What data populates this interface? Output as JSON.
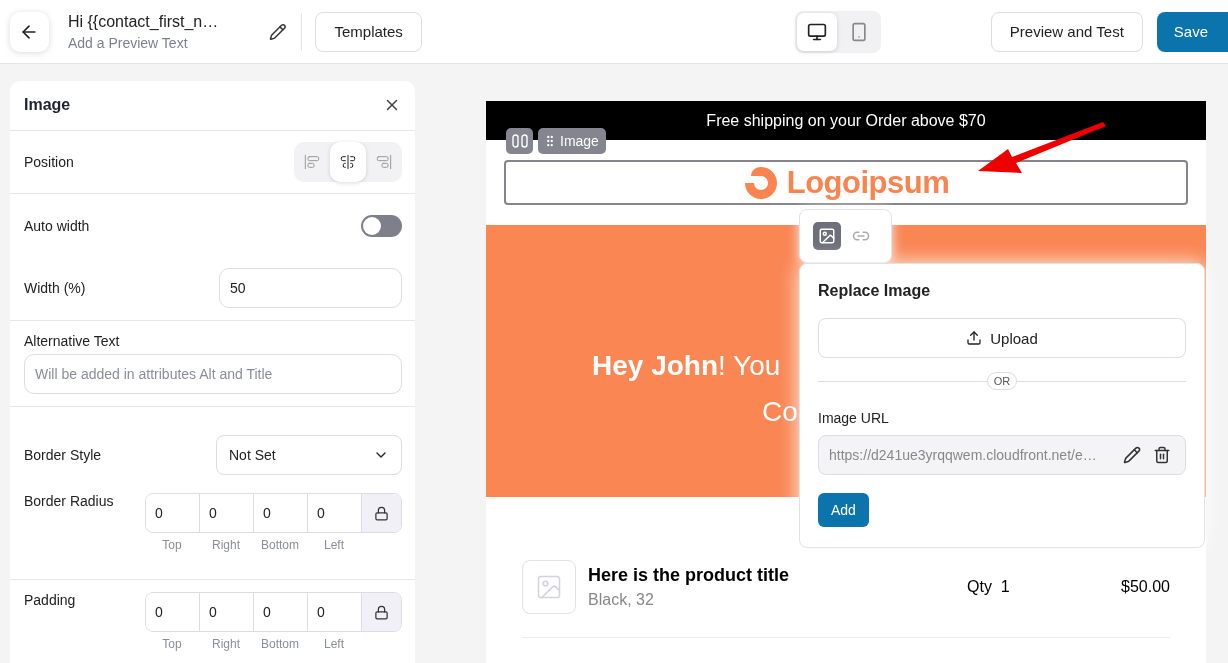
{
  "topbar": {
    "title": "Hi {{contact_first_n…",
    "preview_text": "Add a Preview Text",
    "templates_button": "Templates",
    "devices": [
      {
        "kind": "desktop",
        "selected": true
      },
      {
        "kind": "mobile",
        "selected": false
      }
    ],
    "preview_button": "Preview and Test",
    "save_button": "Save"
  },
  "panel": {
    "title": "Image",
    "position": {
      "label": "Position",
      "options": [
        {
          "kind": "left",
          "selected": false
        },
        {
          "kind": "center",
          "selected": true
        },
        {
          "kind": "right",
          "selected": false
        }
      ]
    },
    "auto_width": {
      "label": "Auto width",
      "on": false
    },
    "width": {
      "label": "Width (%)",
      "value": "50"
    },
    "alt_text": {
      "label": "Alternative Text",
      "placeholder": "Will be added in attributes Alt and Title"
    },
    "border_style": {
      "label": "Border Style",
      "value": "Not Set"
    },
    "border_radius": {
      "label": "Border Radius",
      "sides": [
        {
          "value": "0",
          "caption": "Top"
        },
        {
          "value": "0",
          "caption": "Right"
        },
        {
          "value": "0",
          "caption": "Bottom"
        },
        {
          "value": "0",
          "caption": "Left"
        }
      ]
    },
    "padding": {
      "label": "Padding",
      "sides": [
        {
          "value": "0",
          "caption": "Top"
        },
        {
          "value": "0",
          "caption": "Right"
        },
        {
          "value": "0",
          "caption": "Bottom"
        },
        {
          "value": "0",
          "caption": "Left"
        }
      ]
    }
  },
  "email": {
    "banner": "Free shipping on your Order above $70",
    "block_tag": "Image",
    "logo_text": "Logoipsum",
    "hero_lines": [
      "**Hey John**! You",
      "Co"
    ],
    "product": {
      "title": "Here is the product title",
      "variant": "Black, 32",
      "qty_label": "Qty",
      "qty": "1",
      "price": "$50.00"
    }
  },
  "image_toolbar": [
    {
      "kind": "image",
      "selected": true
    },
    {
      "kind": "link",
      "selected": false
    }
  ],
  "replace_popover": {
    "title": "Replace Image",
    "upload_button": "Upload",
    "divider": "OR",
    "url_label": "Image URL",
    "url_value": "https://d241ue3yrqqwem.cloudfront.net/e…",
    "add_button": "Add"
  }
}
